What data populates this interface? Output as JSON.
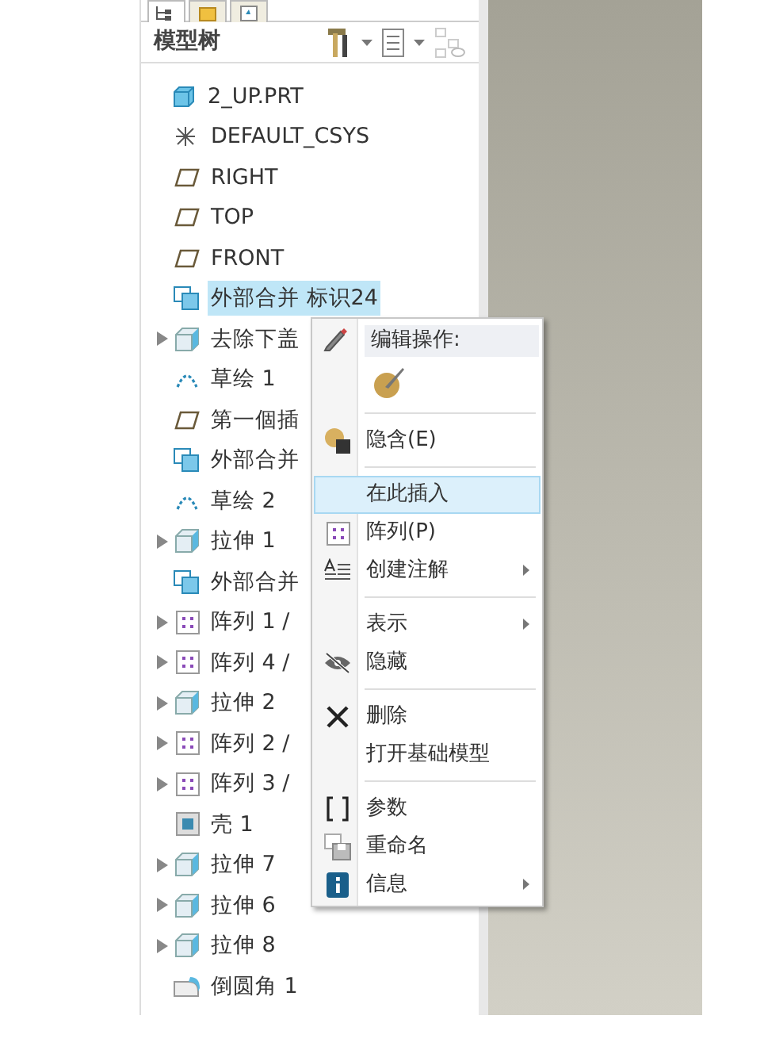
{
  "tabs": [
    {
      "selected": true
    },
    {
      "selected": false
    },
    {
      "selected": false
    }
  ],
  "header": {
    "title": "模型树"
  },
  "tree": [
    {
      "label": "2_UP.PRT",
      "kind": "part",
      "expandable": false,
      "selected": false,
      "children": [
        {
          "label": "DEFAULT_CSYS",
          "kind": "csys",
          "expandable": false,
          "selected": false
        },
        {
          "label": "RIGHT",
          "kind": "plane",
          "expandable": false,
          "selected": false
        },
        {
          "label": "TOP",
          "kind": "plane",
          "expandable": false,
          "selected": false
        },
        {
          "label": "FRONT",
          "kind": "plane",
          "expandable": false,
          "selected": false
        },
        {
          "label": "外部合并 标识24",
          "kind": "merge",
          "expandable": false,
          "selected": true
        },
        {
          "label": "去除下盖",
          "kind": "extrude",
          "expandable": true,
          "selected": false
        },
        {
          "label": "草绘 1",
          "kind": "sketch",
          "expandable": false,
          "selected": false
        },
        {
          "label": "第一個插",
          "kind": "plane",
          "expandable": false,
          "selected": false
        },
        {
          "label": "外部合并",
          "kind": "merge",
          "expandable": false,
          "selected": false
        },
        {
          "label": "草绘 2",
          "kind": "sketch",
          "expandable": false,
          "selected": false
        },
        {
          "label": "拉伸 1",
          "kind": "extrude",
          "expandable": true,
          "selected": false
        },
        {
          "label": "外部合并",
          "kind": "merge",
          "expandable": false,
          "selected": false
        },
        {
          "label": "阵列 1 /",
          "kind": "pattern",
          "expandable": true,
          "selected": false
        },
        {
          "label": "阵列 4 /",
          "kind": "pattern",
          "expandable": true,
          "selected": false
        },
        {
          "label": "拉伸 2",
          "kind": "extrude",
          "expandable": true,
          "selected": false
        },
        {
          "label": "阵列 2 /",
          "kind": "pattern",
          "expandable": true,
          "selected": false
        },
        {
          "label": "阵列 3 /",
          "kind": "pattern",
          "expandable": true,
          "selected": false
        },
        {
          "label": "壳 1",
          "kind": "shell",
          "expandable": false,
          "selected": false
        },
        {
          "label": "拉伸 7",
          "kind": "extrude",
          "expandable": true,
          "selected": false
        },
        {
          "label": "拉伸 6",
          "kind": "extrude",
          "expandable": true,
          "selected": false
        },
        {
          "label": "拉伸 8",
          "kind": "extrude",
          "expandable": true,
          "selected": false
        },
        {
          "label": "倒圆角 1",
          "kind": "round",
          "expandable": false,
          "selected": false
        }
      ]
    }
  ],
  "context_menu": [
    {
      "kind": "header",
      "label": "编辑操作:"
    },
    {
      "kind": "icon-row"
    },
    {
      "kind": "separator"
    },
    {
      "kind": "item",
      "label": "隐含(E)",
      "submenu": false,
      "selected": false
    },
    {
      "kind": "separator"
    },
    {
      "kind": "item",
      "label": "在此插入",
      "submenu": false,
      "selected": true
    },
    {
      "kind": "item",
      "label": "阵列(P)",
      "submenu": false,
      "selected": false
    },
    {
      "kind": "item",
      "label": "创建注解",
      "submenu": true,
      "selected": false
    },
    {
      "kind": "separator"
    },
    {
      "kind": "item",
      "label": "表示",
      "submenu": true,
      "selected": false
    },
    {
      "kind": "item",
      "label": "隐藏",
      "submenu": false,
      "selected": false
    },
    {
      "kind": "separator"
    },
    {
      "kind": "item",
      "label": "删除",
      "submenu": false,
      "selected": false
    },
    {
      "kind": "item",
      "label": "打开基础模型",
      "submenu": false,
      "selected": false
    },
    {
      "kind": "separator"
    },
    {
      "kind": "item",
      "label": "参数",
      "submenu": false,
      "selected": false
    },
    {
      "kind": "item",
      "label": "重命名",
      "submenu": false,
      "selected": false
    },
    {
      "kind": "item",
      "label": "信息",
      "submenu": true,
      "selected": false
    }
  ]
}
